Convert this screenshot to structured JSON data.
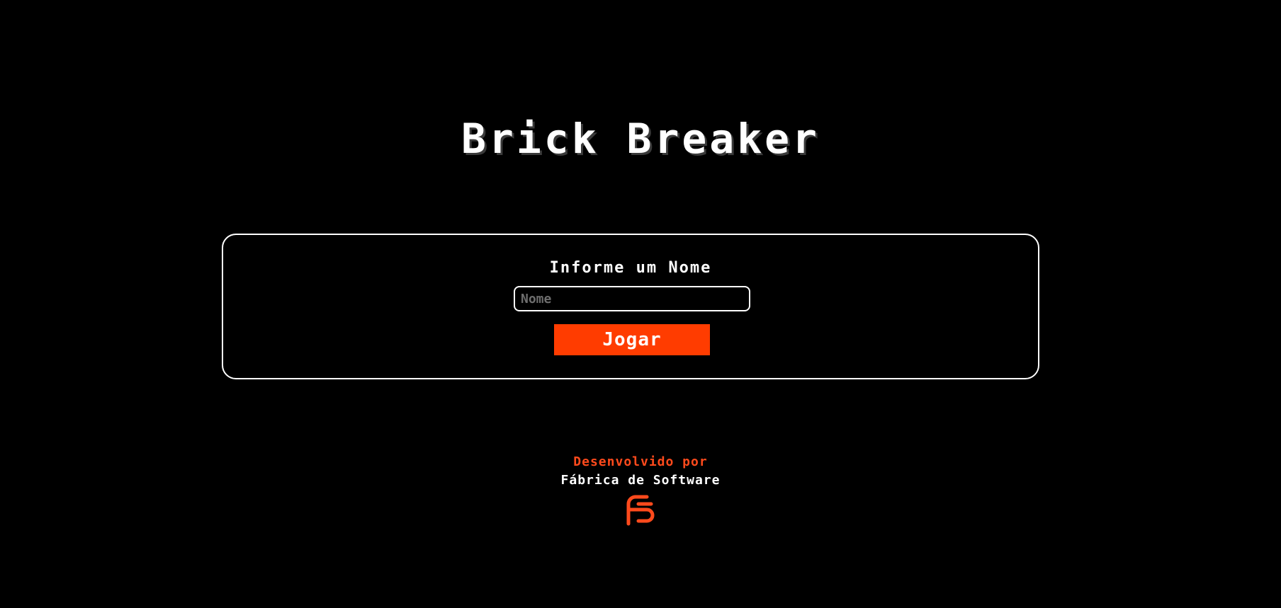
{
  "header": {
    "title": "Brick Breaker"
  },
  "form": {
    "heading": "Informe um Nome",
    "name_value": "",
    "name_placeholder": "Nome",
    "play_label": "Jogar"
  },
  "footer": {
    "developed_by": "Desenvolvido por",
    "company": "Fábrica de Software",
    "logo_icon": "fabrica-de-software-logo-icon"
  },
  "colors": {
    "background": "#000000",
    "accent": "#ff3c00",
    "text": "#ffffff"
  }
}
